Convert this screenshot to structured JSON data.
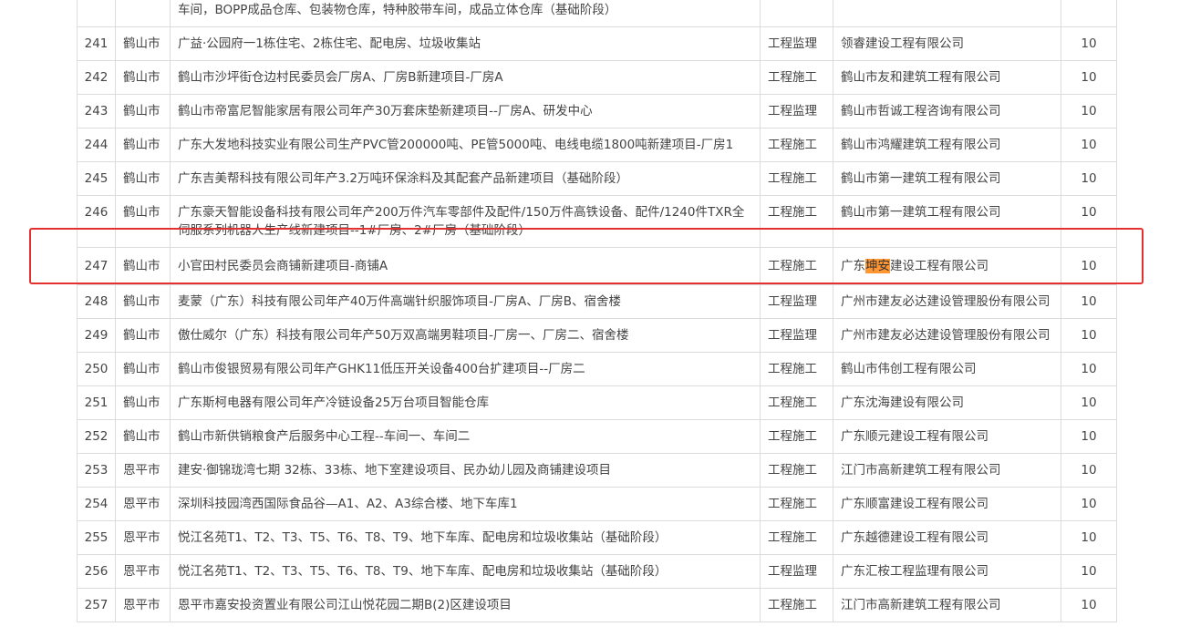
{
  "rows": [
    {
      "no": "",
      "city": "",
      "name": "车间，BOPP成品仓库、包装物仓库，特种胶带车间，成品立体仓库（基础阶段）",
      "type": "",
      "company": "",
      "score": ""
    },
    {
      "no": "241",
      "city": "鹤山市",
      "name": "广益·公园府一1栋住宅、2栋住宅、配电房、垃圾收集站",
      "type": "工程监理",
      "company": "领睿建设工程有限公司",
      "score": "10"
    },
    {
      "no": "242",
      "city": "鹤山市",
      "name": "鹤山市沙坪街仓边村民委员会厂房A、厂房B新建项目-厂房A",
      "type": "工程施工",
      "company": "鹤山市友和建筑工程有限公司",
      "score": "10"
    },
    {
      "no": "243",
      "city": "鹤山市",
      "name": "鹤山市帝富尼智能家居有限公司年产30万套床垫新建项目--厂房A、研发中心",
      "type": "工程监理",
      "company": "鹤山市哲诚工程咨询有限公司",
      "score": "10"
    },
    {
      "no": "244",
      "city": "鹤山市",
      "name": "广东大发地科技实业有限公司生产PVC管200000吨、PE管5000吨、电线电缆1800吨新建项目-厂房1",
      "type": "工程施工",
      "company": "鹤山市鸿耀建筑工程有限公司",
      "score": "10"
    },
    {
      "no": "245",
      "city": "鹤山市",
      "name": "广东吉美帮科技有限公司年产3.2万吨环保涂料及其配套产品新建项目（基础阶段）",
      "type": "工程施工",
      "company": "鹤山市第一建筑工程有限公司",
      "score": "10"
    },
    {
      "no": "246",
      "city": "鹤山市",
      "name": "广东豪天智能设备科技有限公司年产200万件汽车零部件及配件/150万件高铁设备、配件/1240件TXR全伺服系列机器人生产线新建项目--1#厂房、2#厂房（基础阶段）",
      "type": "工程施工",
      "company": "鹤山市第一建筑工程有限公司",
      "score": "10"
    },
    {
      "no": "247",
      "city": "鹤山市",
      "name": "小官田村民委员会商铺新建项目-商铺A",
      "type": "工程施工",
      "company_pre": "广东",
      "company_hl": "坤安",
      "company_post": "建设工程有限公司",
      "score": "10"
    },
    {
      "no": "248",
      "city": "鹤山市",
      "name": "麦蒙（广东）科技有限公司年产40万件高端针织服饰项目-厂房A、厂房B、宿舍楼",
      "type": "工程监理",
      "company": "广州市建友必达建设管理股份有限公司",
      "score": "10"
    },
    {
      "no": "249",
      "city": "鹤山市",
      "name": "傲仕威尔（广东）科技有限公司年产50万双高端男鞋项目-厂房一、厂房二、宿舍楼",
      "type": "工程监理",
      "company": "广州市建友必达建设管理股份有限公司",
      "score": "10"
    },
    {
      "no": "250",
      "city": "鹤山市",
      "name": "鹤山市俊银贸易有限公司年产GHK11低压开关设备400台扩建项目--厂房二",
      "type": "工程施工",
      "company": "鹤山市伟创工程有限公司",
      "score": "10"
    },
    {
      "no": "251",
      "city": "鹤山市",
      "name": "广东斯柯电器有限公司年产冷链设备25万台项目智能仓库",
      "type": "工程施工",
      "company": "广东沈海建设有限公司",
      "score": "10"
    },
    {
      "no": "252",
      "city": "鹤山市",
      "name": "鹤山市新供销粮食产后服务中心工程--车间一、车间二",
      "type": "工程施工",
      "company": "广东顺元建设工程有限公司",
      "score": "10"
    },
    {
      "no": "253",
      "city": "恩平市",
      "name": "建安·御锦珑湾七期 32栋、33栋、地下室建设项目、民办幼儿园及商铺建设项目",
      "type": "工程施工",
      "company": "江门市高新建筑工程有限公司",
      "score": "10"
    },
    {
      "no": "254",
      "city": "恩平市",
      "name": "深圳科技园湾西国际食品谷—A1、A2、A3综合楼、地下车库1",
      "type": "工程施工",
      "company": "广东顺富建设工程有限公司",
      "score": "10"
    },
    {
      "no": "255",
      "city": "恩平市",
      "name": "悦江名苑T1、T2、T3、T5、T6、T8、T9、地下车库、配电房和垃圾收集站（基础阶段）",
      "type": "工程施工",
      "company": "广东越德建设工程有限公司",
      "score": "10"
    },
    {
      "no": "256",
      "city": "恩平市",
      "name": "悦江名苑T1、T2、T3、T5、T6、T8、T9、地下车库、配电房和垃圾收集站（基础阶段）",
      "type": "工程监理",
      "company": "广东汇桉工程监理有限公司",
      "score": "10"
    },
    {
      "no": "257",
      "city": "恩平市",
      "name": "恩平市嘉安投资置业有限公司江山悦花园二期B(2)区建设项目",
      "type": "工程施工",
      "company": "江门市高新建筑工程有限公司",
      "score": "10"
    }
  ],
  "highlight_color": "#ff9632",
  "selection_box_color": "#e53030"
}
